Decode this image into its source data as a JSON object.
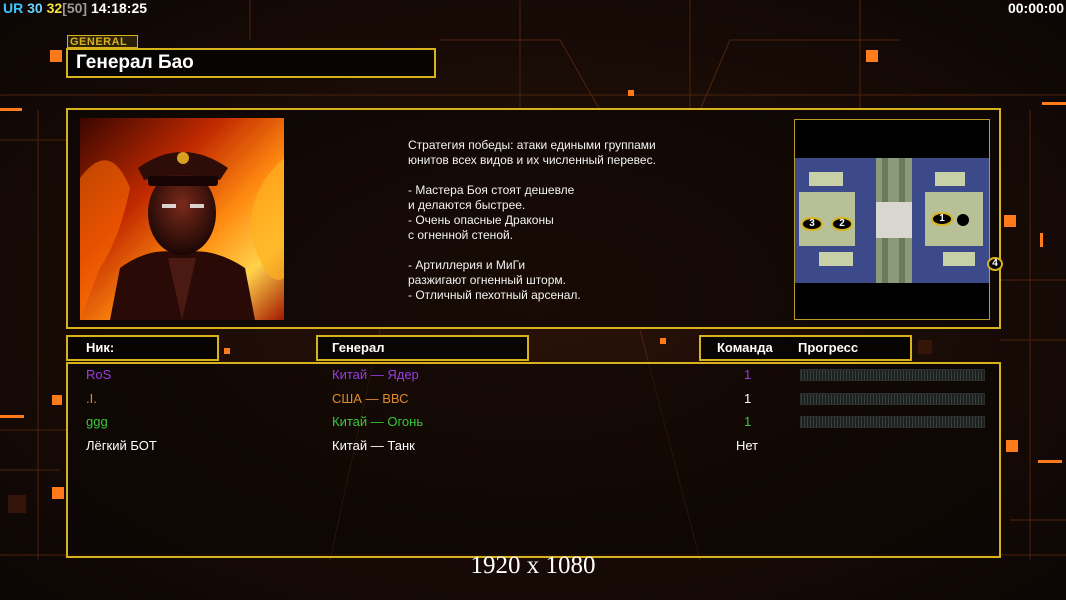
{
  "hud": {
    "left": [
      {
        "text": "UR",
        "color": "#3cc8ff"
      },
      {
        "text": "30",
        "color": "#6cd4ff"
      },
      {
        "text": "32",
        "color": "#f2e23c"
      },
      {
        "text": "[50]",
        "color": "#9a9a9a"
      },
      {
        "text": "14:18:25",
        "color": "#ffffff"
      }
    ],
    "right": "00:00:00"
  },
  "general_tag": "GENERAL",
  "title": "Генерал Бао",
  "description": "Стратегия победы: атаки едиными группами\nюнитов всех видов и их численный перевес.\n\n- Мастера Боя стоят дешевле\nи делаются быстрее.\n- Очень опасные Драконы\nс огненной стеной.\n\n- Артиллерия и МиГи\nразжигают огненный шторм.\n- Отличный пехотный арсенал.",
  "map": {
    "markers": [
      "1",
      "2",
      "3",
      "4"
    ]
  },
  "headers": {
    "nick": "Ник:",
    "general": "Генерал",
    "team": "Команда",
    "progress": "Прогресс"
  },
  "players": [
    {
      "nick": "RoS",
      "general": "Китай — Ядер",
      "team": "1",
      "color": "#9a3ce0",
      "team_color": "#9a3ce0",
      "bar": true
    },
    {
      "nick": ".I.",
      "general": "США — ВВС",
      "team": "1",
      "color": "#e08a2c",
      "team_color": "#ffffff",
      "bar": true
    },
    {
      "nick": "ggg",
      "general": "Китай — Огонь",
      "team": "1",
      "color": "#38c838",
      "team_color": "#38c838",
      "bar": true
    },
    {
      "nick": "Лёгкий БОТ",
      "general": "Китай — Танк",
      "team": "Нет",
      "color": "#ffffff",
      "team_color": "#ffffff",
      "bar": false
    }
  ],
  "resolution": "1920 x 1080"
}
